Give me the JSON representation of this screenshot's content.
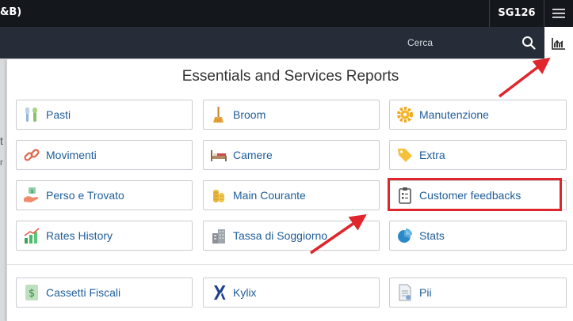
{
  "topbar": {
    "title": "&B)",
    "property_code": "SG126",
    "menu_icon": "hamburger-icon"
  },
  "subbar": {
    "search_placeholder": "Cerca",
    "search_icon": "search-icon",
    "reports_icon": "bar-chart-icon"
  },
  "background": {
    "scrap_1": "t",
    "scrap_2": "r"
  },
  "panel": {
    "title": "Essentials and Services Reports",
    "tiles": [
      {
        "label": "Pasti",
        "icon": "cutlery-icon"
      },
      {
        "label": "Broom",
        "icon": "broom-icon"
      },
      {
        "label": "Manutenzione",
        "icon": "gear-icon"
      },
      {
        "label": "Movimenti",
        "icon": "link-icon"
      },
      {
        "label": "Camere",
        "icon": "bed-icon"
      },
      {
        "label": "Extra",
        "icon": "tag-icon"
      },
      {
        "label": "Perso e Trovato",
        "icon": "hand-icon"
      },
      {
        "label": "Main Courante",
        "icon": "coins-icon"
      },
      {
        "label": "Customer feedbacks",
        "icon": "clipboard-icon"
      },
      {
        "label": "Rates History",
        "icon": "bar-chart-icon"
      },
      {
        "label": "Tassa di Soggiorno",
        "icon": "building-icon"
      },
      {
        "label": "Stats",
        "icon": "pie-chart-icon"
      }
    ],
    "tiles_bottom": [
      {
        "label": "Cassetti Fiscali",
        "icon": "dollar-icon"
      },
      {
        "label": "Kylix",
        "icon": "kylix-logo-icon"
      },
      {
        "label": "Pii",
        "icon": "document-icon"
      }
    ]
  },
  "colors": {
    "topbar_bg": "#14171c",
    "subbar_bg": "#262d38",
    "link_text": "#1f5d99",
    "annotation_red": "#e0252c"
  }
}
